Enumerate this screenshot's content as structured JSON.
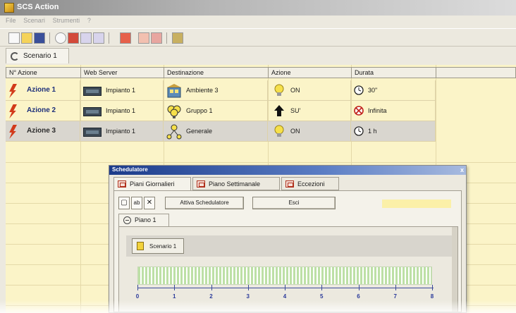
{
  "window": {
    "title": "SCS Action"
  },
  "menu": [
    "File",
    "Scenari",
    "Strumenti",
    "?"
  ],
  "scenario_tab": {
    "label": "Scenario 1"
  },
  "grid": {
    "columns": [
      "N° Azione",
      "Web Server",
      "Destinazione",
      "Azione",
      "Durata"
    ],
    "rows": [
      {
        "action": "Azione 1",
        "server": "Impianto 1",
        "destination": "Ambiente 3",
        "destination_icon": "room-icon",
        "command": "ON",
        "command_icon": "bulb-icon",
        "duration": "30\"",
        "duration_icon": "clock-icon"
      },
      {
        "action": "Azione 2",
        "server": "Impianto 1",
        "destination": "Gruppo 1",
        "destination_icon": "group-bulbs-icon",
        "command": "SU'",
        "command_icon": "arrow-up-icon",
        "duration": "Infinita",
        "duration_icon": "clock-disabled-icon"
      },
      {
        "action": "Azione 3",
        "server": "Impianto 1",
        "destination": "Generale",
        "destination_icon": "general-icon",
        "command": "ON",
        "command_icon": "bulb-icon",
        "duration": "1 h",
        "duration_icon": "clock-icon"
      }
    ]
  },
  "scheduler": {
    "title": "Schedulatore",
    "close": "x",
    "tabs": [
      "Piani Giornalieri",
      "Piano Settimanale",
      "Eccezioni"
    ],
    "buttons": {
      "activate": "Attiva Schedulatore",
      "exit": "Esci"
    },
    "plan_tab": "Piano 1",
    "scenario_chip": "Scenario 1",
    "timeline_labels": [
      "0",
      "1",
      "2",
      "3",
      "4",
      "5",
      "6",
      "7",
      "8"
    ]
  },
  "colors": {
    "grid_bg": "#fbf4c8",
    "action_text": "#1d2f7a",
    "title_bar": "#1b3b8a",
    "ruler_bar": "#bde0a6"
  }
}
